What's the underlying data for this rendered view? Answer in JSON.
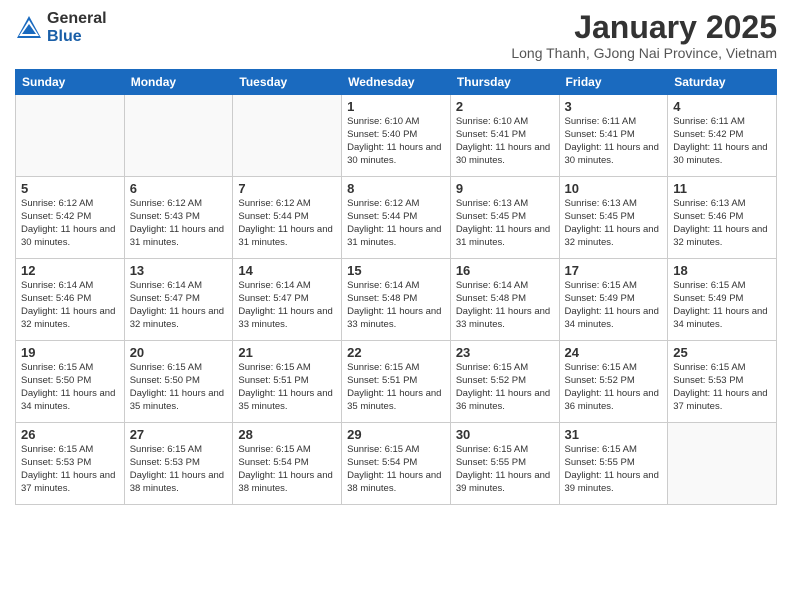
{
  "logo": {
    "general": "General",
    "blue": "Blue"
  },
  "title": "January 2025",
  "location": "Long Thanh, GJong Nai Province, Vietnam",
  "days_of_week": [
    "Sunday",
    "Monday",
    "Tuesday",
    "Wednesday",
    "Thursday",
    "Friday",
    "Saturday"
  ],
  "weeks": [
    [
      {
        "day": "",
        "info": ""
      },
      {
        "day": "",
        "info": ""
      },
      {
        "day": "",
        "info": ""
      },
      {
        "day": "1",
        "info": "Sunrise: 6:10 AM\nSunset: 5:40 PM\nDaylight: 11 hours and 30 minutes."
      },
      {
        "day": "2",
        "info": "Sunrise: 6:10 AM\nSunset: 5:41 PM\nDaylight: 11 hours and 30 minutes."
      },
      {
        "day": "3",
        "info": "Sunrise: 6:11 AM\nSunset: 5:41 PM\nDaylight: 11 hours and 30 minutes."
      },
      {
        "day": "4",
        "info": "Sunrise: 6:11 AM\nSunset: 5:42 PM\nDaylight: 11 hours and 30 minutes."
      }
    ],
    [
      {
        "day": "5",
        "info": "Sunrise: 6:12 AM\nSunset: 5:42 PM\nDaylight: 11 hours and 30 minutes."
      },
      {
        "day": "6",
        "info": "Sunrise: 6:12 AM\nSunset: 5:43 PM\nDaylight: 11 hours and 31 minutes."
      },
      {
        "day": "7",
        "info": "Sunrise: 6:12 AM\nSunset: 5:44 PM\nDaylight: 11 hours and 31 minutes."
      },
      {
        "day": "8",
        "info": "Sunrise: 6:12 AM\nSunset: 5:44 PM\nDaylight: 11 hours and 31 minutes."
      },
      {
        "day": "9",
        "info": "Sunrise: 6:13 AM\nSunset: 5:45 PM\nDaylight: 11 hours and 31 minutes."
      },
      {
        "day": "10",
        "info": "Sunrise: 6:13 AM\nSunset: 5:45 PM\nDaylight: 11 hours and 32 minutes."
      },
      {
        "day": "11",
        "info": "Sunrise: 6:13 AM\nSunset: 5:46 PM\nDaylight: 11 hours and 32 minutes."
      }
    ],
    [
      {
        "day": "12",
        "info": "Sunrise: 6:14 AM\nSunset: 5:46 PM\nDaylight: 11 hours and 32 minutes."
      },
      {
        "day": "13",
        "info": "Sunrise: 6:14 AM\nSunset: 5:47 PM\nDaylight: 11 hours and 32 minutes."
      },
      {
        "day": "14",
        "info": "Sunrise: 6:14 AM\nSunset: 5:47 PM\nDaylight: 11 hours and 33 minutes."
      },
      {
        "day": "15",
        "info": "Sunrise: 6:14 AM\nSunset: 5:48 PM\nDaylight: 11 hours and 33 minutes."
      },
      {
        "day": "16",
        "info": "Sunrise: 6:14 AM\nSunset: 5:48 PM\nDaylight: 11 hours and 33 minutes."
      },
      {
        "day": "17",
        "info": "Sunrise: 6:15 AM\nSunset: 5:49 PM\nDaylight: 11 hours and 34 minutes."
      },
      {
        "day": "18",
        "info": "Sunrise: 6:15 AM\nSunset: 5:49 PM\nDaylight: 11 hours and 34 minutes."
      }
    ],
    [
      {
        "day": "19",
        "info": "Sunrise: 6:15 AM\nSunset: 5:50 PM\nDaylight: 11 hours and 34 minutes."
      },
      {
        "day": "20",
        "info": "Sunrise: 6:15 AM\nSunset: 5:50 PM\nDaylight: 11 hours and 35 minutes."
      },
      {
        "day": "21",
        "info": "Sunrise: 6:15 AM\nSunset: 5:51 PM\nDaylight: 11 hours and 35 minutes."
      },
      {
        "day": "22",
        "info": "Sunrise: 6:15 AM\nSunset: 5:51 PM\nDaylight: 11 hours and 35 minutes."
      },
      {
        "day": "23",
        "info": "Sunrise: 6:15 AM\nSunset: 5:52 PM\nDaylight: 11 hours and 36 minutes."
      },
      {
        "day": "24",
        "info": "Sunrise: 6:15 AM\nSunset: 5:52 PM\nDaylight: 11 hours and 36 minutes."
      },
      {
        "day": "25",
        "info": "Sunrise: 6:15 AM\nSunset: 5:53 PM\nDaylight: 11 hours and 37 minutes."
      }
    ],
    [
      {
        "day": "26",
        "info": "Sunrise: 6:15 AM\nSunset: 5:53 PM\nDaylight: 11 hours and 37 minutes."
      },
      {
        "day": "27",
        "info": "Sunrise: 6:15 AM\nSunset: 5:53 PM\nDaylight: 11 hours and 38 minutes."
      },
      {
        "day": "28",
        "info": "Sunrise: 6:15 AM\nSunset: 5:54 PM\nDaylight: 11 hours and 38 minutes."
      },
      {
        "day": "29",
        "info": "Sunrise: 6:15 AM\nSunset: 5:54 PM\nDaylight: 11 hours and 38 minutes."
      },
      {
        "day": "30",
        "info": "Sunrise: 6:15 AM\nSunset: 5:55 PM\nDaylight: 11 hours and 39 minutes."
      },
      {
        "day": "31",
        "info": "Sunrise: 6:15 AM\nSunset: 5:55 PM\nDaylight: 11 hours and 39 minutes."
      },
      {
        "day": "",
        "info": ""
      }
    ]
  ]
}
